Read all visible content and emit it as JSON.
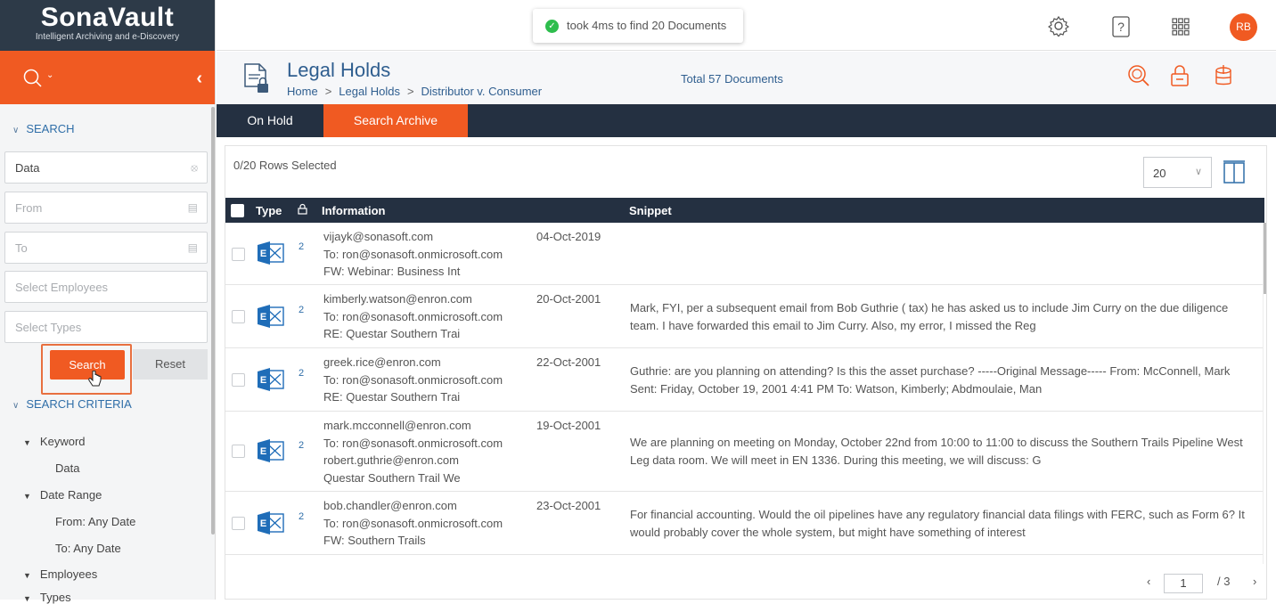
{
  "brand": {
    "name": "SonaVault",
    "tagline": "Intelligent Archiving and e-Discovery"
  },
  "toast": {
    "message": "took 4ms to find 20 Documents"
  },
  "user": {
    "initials": "RB"
  },
  "sidebar": {
    "search_header": "SEARCH",
    "keyword_value": "Data",
    "from_placeholder": "From",
    "to_placeholder": "To",
    "employees_placeholder": "Select Employees",
    "types_placeholder": "Select Types",
    "search_label": "Search",
    "reset_label": "Reset",
    "criteria_header": "SEARCH CRITERIA",
    "criteria": {
      "keyword": "Keyword",
      "keyword_value": "Data",
      "date_range": "Date Range",
      "from": "From: Any Date",
      "to": "To: Any Date",
      "employees": "Employees",
      "types": "Types"
    }
  },
  "header": {
    "title": "Legal Holds",
    "breadcrumb": [
      "Home",
      "Legal Holds",
      "Distributor v. Consumer"
    ],
    "total": "Total 57 Documents"
  },
  "tabs": [
    "On Hold",
    "Search Archive"
  ],
  "table": {
    "rows_selected": "0/20 Rows Selected",
    "page_size": "20",
    "columns": {
      "type": "Type",
      "information": "Information",
      "snippet": "Snippet"
    },
    "rows": [
      {
        "count": "2",
        "info": [
          "vijayk@sonasoft.com",
          "To: ron@sonasoft.onmicrosoft.com",
          "FW: Webinar: Business Int"
        ],
        "date": "04-Oct-2019",
        "snippet": ""
      },
      {
        "count": "2",
        "info": [
          "kimberly.watson@enron.com",
          "To: ron@sonasoft.onmicrosoft.com",
          "RE: Questar Southern Trai"
        ],
        "date": "20-Oct-2001",
        "snippet": "Mark, FYI, per a subsequent email from Bob Guthrie ( tax) he has asked us to include Jim Curry on the due diligence team. I have forwarded this email to Jim Curry. Also, my error, I missed the Reg"
      },
      {
        "count": "2",
        "info": [
          "greek.rice@enron.com",
          "To: ron@sonasoft.onmicrosoft.com",
          "RE: Questar Southern Trai"
        ],
        "date": "22-Oct-2001",
        "snippet": "Guthrie: are you planning on attending? Is this the asset purchase? -----Original Message----- From: McConnell, Mark Sent: Friday, October 19, 2001 4:41 PM To: Watson, Kimberly; Abdmoulaie, Man"
      },
      {
        "count": "2",
        "info": [
          "mark.mcconnell@enron.com",
          "To: ron@sonasoft.onmicrosoft.com",
          "robert.guthrie@enron.com",
          "Questar Southern Trail We"
        ],
        "date": "19-Oct-2001",
        "snippet": "We are planning on meeting on Monday, October 22nd from 10:00 to 11:00 to discuss the Southern Trails Pipeline West Leg data room. We will meet in EN 1336. During this meeting, we will discuss: G"
      },
      {
        "count": "2",
        "info": [
          "bob.chandler@enron.com",
          "To: ron@sonasoft.onmicrosoft.com",
          "FW: Southern Trails"
        ],
        "date": "23-Oct-2001",
        "snippet": "For financial accounting. Would the oil pipelines have any regulatory financial data filings with FERC, such as Form 6? It would probably cover the whole system, but might have something of interest"
      }
    ]
  },
  "pager": {
    "current": "1",
    "total": "/ 3"
  },
  "colors": {
    "accent": "#f05a22",
    "navy": "#243041",
    "link": "#2f5e8f"
  }
}
